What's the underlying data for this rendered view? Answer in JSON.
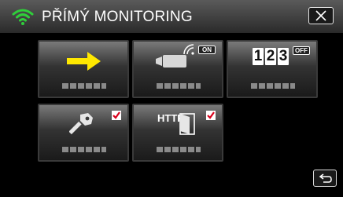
{
  "header": {
    "title": "PŘÍMÝ MONITORING",
    "wifi_icon": "wifi-icon",
    "close_icon": "close-icon"
  },
  "tiles": [
    {
      "name": "arrow-tile",
      "icon": "arrow-right-icon",
      "color": "#ffe800"
    },
    {
      "name": "camera-tile",
      "icon": "video-camera-icon",
      "badge": "ON"
    },
    {
      "name": "counter-tile",
      "icon": "counter-icon",
      "digits": [
        "1",
        "2",
        "3"
      ],
      "badge": "OFF"
    },
    {
      "name": "password-tile",
      "icon": "key-icon",
      "checked": true
    },
    {
      "name": "http-tile",
      "icon": "http-door-icon",
      "label": "HTTP",
      "checked": true
    }
  ],
  "footer": {
    "back_icon": "back-icon"
  },
  "colors": {
    "accent": "#ffe800",
    "check": "#d9001b",
    "background": "#000000"
  }
}
